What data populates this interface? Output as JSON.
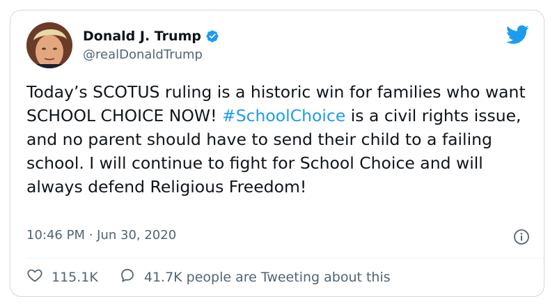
{
  "author": {
    "display_name": "Donald J. Trump",
    "handle": "@realDonaldTrump",
    "verified": true
  },
  "tweet": {
    "text_before_hashtag": "Today’s SCOTUS ruling is a historic win for families who want SCHOOL CHOICE NOW! ",
    "hashtag": "#SchoolChoice",
    "text_after_hashtag": " is a civil rights issue, and no parent should have to send their child to a failing school. I will continue to fight for School Choice and will always defend Religious Freedom!",
    "timestamp": "10:46 PM · Jun 30, 2020"
  },
  "stats": {
    "likes": "115.1K",
    "conversation": "41.7K people are Tweeting about this"
  },
  "icons": {
    "brand": "twitter-bird-icon",
    "verified": "verified-badge-icon",
    "info": "info-icon",
    "like": "heart-icon",
    "reply": "speech-bubble-icon"
  },
  "colors": {
    "accent": "#1d9bf0",
    "text": "#0f1419",
    "secondary": "#536471",
    "border": "#cfd9de"
  }
}
